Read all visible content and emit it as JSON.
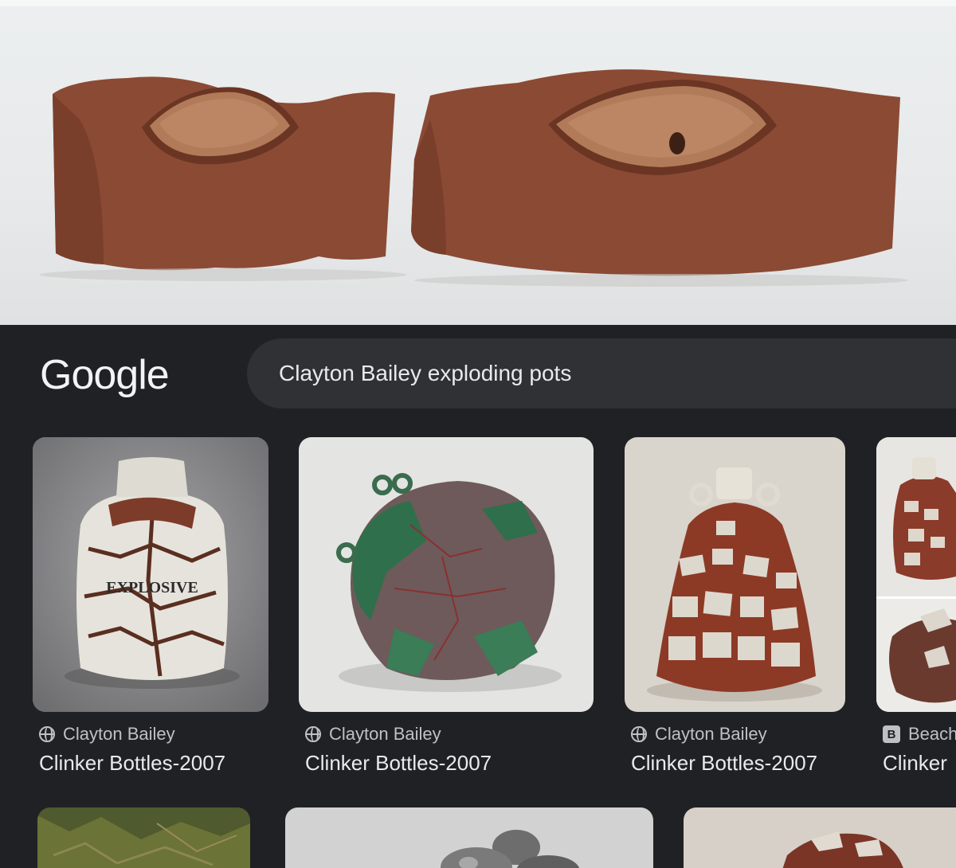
{
  "header": {
    "logo_text": "Google",
    "search_query": "Clayton Bailey exploding pots"
  },
  "results": [
    {
      "source": "Clayton Bailey",
      "title": "Clinker Bottles-2007",
      "source_icon": "globe-icon"
    },
    {
      "source": "Clayton Bailey",
      "title": "Clinker Bottles-2007",
      "source_icon": "globe-icon"
    },
    {
      "source": "Clayton Bailey",
      "title": "Clinker Bottles-2007",
      "source_icon": "globe-icon"
    },
    {
      "source": "Beach",
      "title": "Clinker",
      "source_icon": "b-site-icon"
    }
  ],
  "image_labels": {
    "explosive_text": "EXPLOSIVE"
  },
  "colors": {
    "background": "#202124",
    "searchbar": "#303134",
    "text_primary": "#e8eaed",
    "text_secondary": "#bdc1c6",
    "clay": "#8a4a33"
  }
}
